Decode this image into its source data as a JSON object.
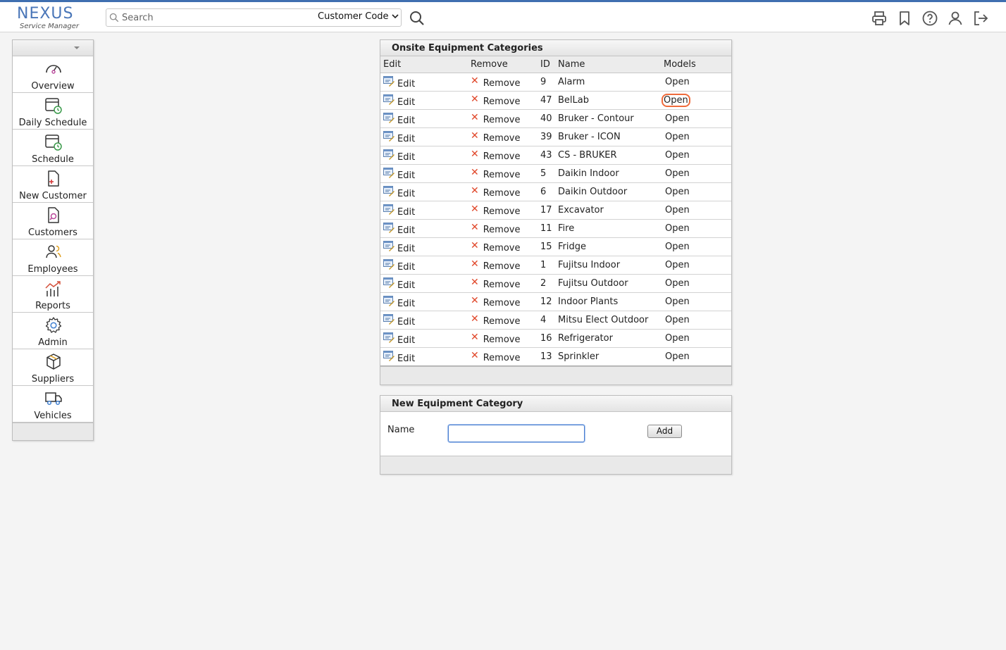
{
  "header": {
    "logo_brand": "NEXUS",
    "logo_sub": "Service Manager",
    "search_placeholder": "Search",
    "search_field_selected": "Customer Code",
    "icons": [
      "printer-icon",
      "bookmark-icon",
      "help-icon",
      "user-icon",
      "logout-icon"
    ]
  },
  "sidebar": {
    "items": [
      {
        "label": "Overview",
        "icon": "gauge-icon"
      },
      {
        "label": "Daily Schedule",
        "icon": "calendar-clock-icon"
      },
      {
        "label": "Schedule",
        "icon": "calendar-clock-icon"
      },
      {
        "label": "New Customer",
        "icon": "file-plus-icon"
      },
      {
        "label": "Customers",
        "icon": "file-search-icon"
      },
      {
        "label": "Employees",
        "icon": "users-icon"
      },
      {
        "label": "Reports",
        "icon": "chart-icon"
      },
      {
        "label": "Admin",
        "icon": "gear-icon"
      },
      {
        "label": "Suppliers",
        "icon": "box-icon"
      },
      {
        "label": "Vehicles",
        "icon": "truck-icon"
      }
    ]
  },
  "categories_panel": {
    "title": "Onsite Equipment Categories",
    "columns": {
      "edit": "Edit",
      "remove": "Remove",
      "id": "ID",
      "name": "Name",
      "models": "Models"
    },
    "rows": [
      {
        "edit": "Edit",
        "remove": "Remove",
        "id": "9",
        "name": "Alarm",
        "models": "Open"
      },
      {
        "edit": "Edit",
        "remove": "Remove",
        "id": "47",
        "name": "BelLab",
        "models": "Open"
      },
      {
        "edit": "Edit",
        "remove": "Remove",
        "id": "40",
        "name": "Bruker - Contour",
        "models": "Open"
      },
      {
        "edit": "Edit",
        "remove": "Remove",
        "id": "39",
        "name": "Bruker - ICON",
        "models": "Open"
      },
      {
        "edit": "Edit",
        "remove": "Remove",
        "id": "43",
        "name": "CS - BRUKER",
        "models": "Open"
      },
      {
        "edit": "Edit",
        "remove": "Remove",
        "id": "5",
        "name": "Daikin Indoor",
        "models": "Open"
      },
      {
        "edit": "Edit",
        "remove": "Remove",
        "id": "6",
        "name": "Daikin Outdoor",
        "models": "Open"
      },
      {
        "edit": "Edit",
        "remove": "Remove",
        "id": "17",
        "name": "Excavator",
        "models": "Open"
      },
      {
        "edit": "Edit",
        "remove": "Remove",
        "id": "11",
        "name": "Fire",
        "models": "Open"
      },
      {
        "edit": "Edit",
        "remove": "Remove",
        "id": "15",
        "name": "Fridge",
        "models": "Open"
      },
      {
        "edit": "Edit",
        "remove": "Remove",
        "id": "1",
        "name": "Fujitsu Indoor",
        "models": "Open"
      },
      {
        "edit": "Edit",
        "remove": "Remove",
        "id": "2",
        "name": "Fujitsu Outdoor",
        "models": "Open"
      },
      {
        "edit": "Edit",
        "remove": "Remove",
        "id": "12",
        "name": "Indoor Plants",
        "models": "Open"
      },
      {
        "edit": "Edit",
        "remove": "Remove",
        "id": "4",
        "name": "Mitsu Elect Outdoor",
        "models": "Open"
      },
      {
        "edit": "Edit",
        "remove": "Remove",
        "id": "16",
        "name": "Refrigerator",
        "models": "Open"
      },
      {
        "edit": "Edit",
        "remove": "Remove",
        "id": "13",
        "name": "Sprinkler",
        "models": "Open"
      }
    ],
    "focused_row_index": 1
  },
  "new_category_panel": {
    "title": "New Equipment Category",
    "name_label": "Name",
    "name_value": "",
    "add_label": "Add"
  },
  "colors": {
    "accent": "#3f6fb0",
    "remove_x": "#e0472a",
    "focus_ring": "#ef6b3b"
  }
}
